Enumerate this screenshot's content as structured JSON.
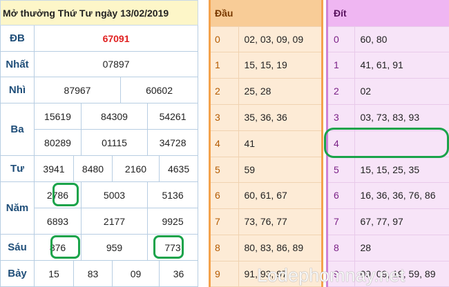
{
  "results": {
    "title": "Mở thưởng Thứ Tư ngày 13/02/2019",
    "rows": [
      {
        "label": "ĐB",
        "values": [
          "67091"
        ]
      },
      {
        "label": "Nhất",
        "values": [
          "07897"
        ]
      },
      {
        "label": "Nhì",
        "values": [
          "87967",
          "60602"
        ]
      },
      {
        "label": "Ba",
        "values": [
          "15619",
          "84309",
          "54261",
          "80289",
          "01115",
          "34728"
        ]
      },
      {
        "label": "Tư",
        "values": [
          "3941",
          "8480",
          "2160",
          "4635"
        ]
      },
      {
        "label": "Năm",
        "values": [
          "2786",
          "5003",
          "5136",
          "6893",
          "2177",
          "9925"
        ]
      },
      {
        "label": "Sáu",
        "values": [
          "876",
          "959",
          "773"
        ]
      },
      {
        "label": "Bảy",
        "values": [
          "15",
          "83",
          "09",
          "36"
        ]
      }
    ]
  },
  "dau": {
    "header": "Đầu",
    "rows": [
      {
        "k": "0",
        "v": "02, 03, 09, 09"
      },
      {
        "k": "1",
        "v": "15, 15, 19"
      },
      {
        "k": "2",
        "v": "25, 28"
      },
      {
        "k": "3",
        "v": "35, 36, 36"
      },
      {
        "k": "4",
        "v": "41"
      },
      {
        "k": "5",
        "v": "59"
      },
      {
        "k": "6",
        "v": "60, 61, 67"
      },
      {
        "k": "7",
        "v": "73, 76, 77"
      },
      {
        "k": "8",
        "v": "80, 83, 86, 89"
      },
      {
        "k": "9",
        "v": "91, 93, 97"
      }
    ]
  },
  "dit": {
    "header": "Đít",
    "rows": [
      {
        "k": "0",
        "v": "60, 80"
      },
      {
        "k": "1",
        "v": "41, 61, 91"
      },
      {
        "k": "2",
        "v": "02"
      },
      {
        "k": "3",
        "v": "03, 73, 83, 93"
      },
      {
        "k": "4",
        "v": ""
      },
      {
        "k": "5",
        "v": "15, 15, 25, 35"
      },
      {
        "k": "6",
        "v": "16, 36, 36, 76, 86"
      },
      {
        "k": "7",
        "v": "67, 77, 97"
      },
      {
        "k": "8",
        "v": "28"
      },
      {
        "k": "9",
        "v": "09, 09, 19, 59, 89"
      }
    ]
  },
  "watermark": "Lodephomnay.net",
  "colors": {
    "special_prize": "#e02020",
    "highlight_ring": "#1aa34a",
    "dau_accent": "#f4a24c",
    "dit_accent": "#ce82d6"
  }
}
